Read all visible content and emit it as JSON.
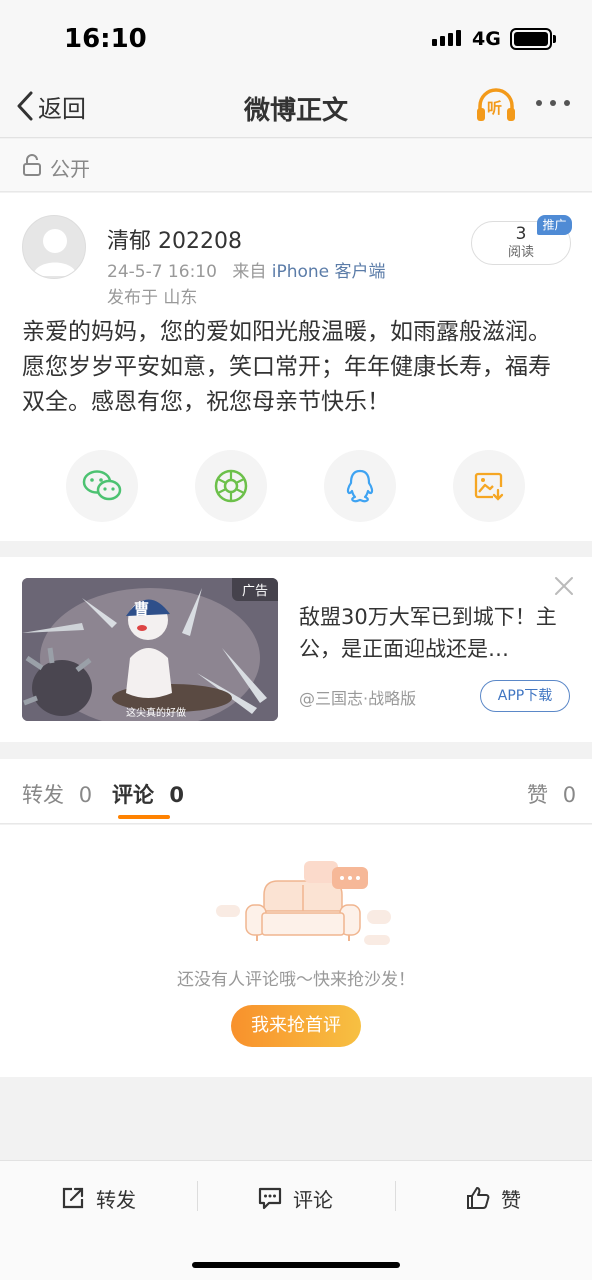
{
  "status_bar": {
    "time": "16:10",
    "network": "4G",
    "icons": [
      "signal-icon",
      "battery-icon"
    ]
  },
  "nav": {
    "back_label": "返回",
    "title": "微博正文",
    "listen_label": "听",
    "icons": [
      "back-chevron-icon",
      "headphones-icon",
      "more-dots-icon"
    ]
  },
  "visibility": {
    "label": "公开",
    "icon": "unlock-icon"
  },
  "post": {
    "author": "清郁 202208",
    "time": "24-5-7 16:10",
    "source_prefix": "来自",
    "source": "iPhone 客户端",
    "location": "发布于 山东",
    "read_count": "3",
    "read_label": "阅读",
    "promo_badge": "推广",
    "content": "亲爱的妈妈，您的爱如阳光般温暖，如雨露般滋润。愿您岁岁平安如意，笑口常开；年年健康长寿，福寿双全。感恩有您，祝您母亲节快乐！",
    "share_icons": [
      "wechat-icon",
      "moments-icon",
      "qq-icon",
      "save-image-icon"
    ]
  },
  "ad": {
    "tag": "广告",
    "title": "敌盟30万大军已到城下！主公，是正面迎战还是…",
    "source": "@三国志·战略版",
    "button": "APP下载",
    "image_caption": "这尖真的好做",
    "image_banner": "曹"
  },
  "tabs": [
    {
      "label": "转发",
      "count": "0"
    },
    {
      "label": "评论",
      "count": "0"
    },
    {
      "label": "赞",
      "count": "0"
    }
  ],
  "comments": {
    "empty_text": "还没有人评论哦～快来抢沙发！",
    "first_button": "我来抢首评"
  },
  "bottom_bar": [
    {
      "label": "转发",
      "icon": "share-icon"
    },
    {
      "label": "评论",
      "icon": "comment-icon"
    },
    {
      "label": "赞",
      "icon": "thumbs-up-icon"
    }
  ],
  "colors": {
    "accent": "#ff8200",
    "link": "#5b7ca8",
    "ad_button": "#3f75c2",
    "promo": "#4f8bd5"
  }
}
